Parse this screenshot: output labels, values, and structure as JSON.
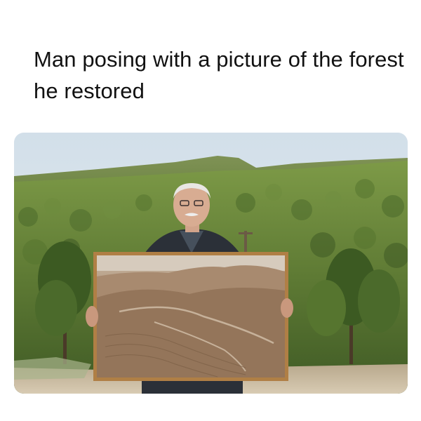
{
  "post": {
    "caption": "Man posing with a picture of the forest he restored"
  },
  "photo": {
    "subject": "elderly man holding a framed sepia photograph of barren eroded hills in front of a restored pine forest",
    "colors": {
      "sky": "#dfe8ef",
      "forest_dark": "#4f6b2f",
      "forest_light": "#8ea65a",
      "frame": "#b07f45",
      "sepia": "#a38367",
      "jacket": "#2b3038"
    }
  }
}
